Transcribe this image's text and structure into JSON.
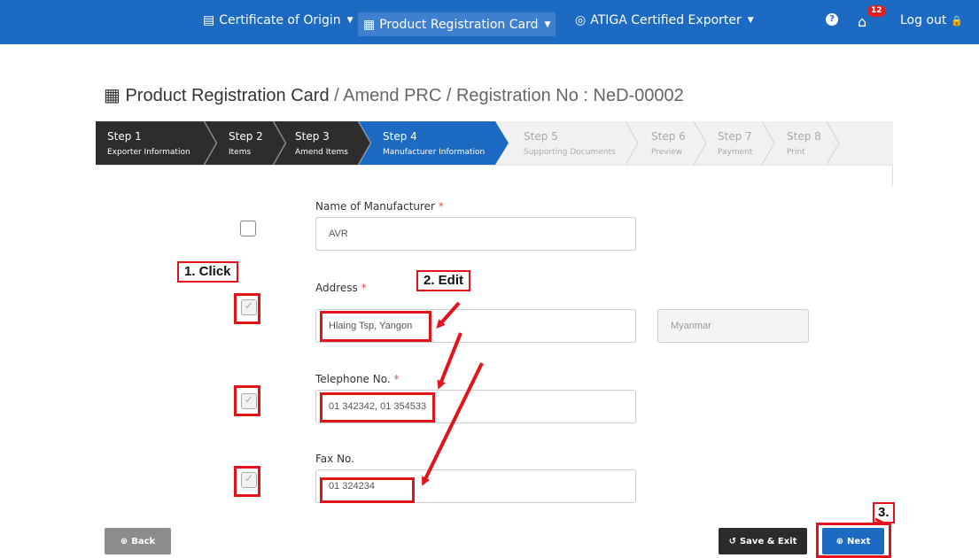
{
  "nav": {
    "certificate_of_origin": "Certificate of Origin",
    "product_registration_card": "Product Registration Card",
    "atiga_certified_exporter": "ATIGA Certified Exporter",
    "notification_count": "12",
    "logout": "Log out"
  },
  "page_title": {
    "section": "Product Registration Card",
    "separator1": " / ",
    "action": "Amend PRC",
    "separator2": " / ",
    "registration": "Registration No : NeD-00002"
  },
  "steps": [
    {
      "num": "Step 1",
      "label": "Exporter Information",
      "state": "done"
    },
    {
      "num": "Step 2",
      "label": "Items",
      "state": "done"
    },
    {
      "num": "Step 3",
      "label": "Amend Items",
      "state": "done"
    },
    {
      "num": "Step 4",
      "label": "Manufacturer Information",
      "state": "current"
    },
    {
      "num": "Step 5",
      "label": "Supporting Documents",
      "state": "todo"
    },
    {
      "num": "Step 6",
      "label": "Preview",
      "state": "todo"
    },
    {
      "num": "Step 7",
      "label": "Payment",
      "state": "todo"
    },
    {
      "num": "Step 8",
      "label": "Print",
      "state": "todo"
    }
  ],
  "form": {
    "manufacturer_name": {
      "label": "Name of Manufacturer",
      "required_mark": "*",
      "value": "AVR",
      "checked": false
    },
    "address": {
      "label": "Address",
      "required_mark": "*",
      "value": "Hlaing Tsp, Yangon",
      "country": "Myanmar",
      "checked": true
    },
    "telephone": {
      "label": "Telephone No.",
      "required_mark": "*",
      "value": "01 342342, 01 354533",
      "checked": true
    },
    "fax": {
      "label": "Fax No.",
      "value": "01 324234",
      "checked": true
    }
  },
  "annotations": {
    "click": "1. Click",
    "edit": "2. Edit",
    "next": "3."
  },
  "buttons": {
    "back": "Back",
    "save_exit": "Save & Exit",
    "next": "Next"
  },
  "colors": {
    "brand_blue": "#1d6ac3",
    "annotation_red": "#e0141a",
    "step_done": "#2d2d2d"
  }
}
